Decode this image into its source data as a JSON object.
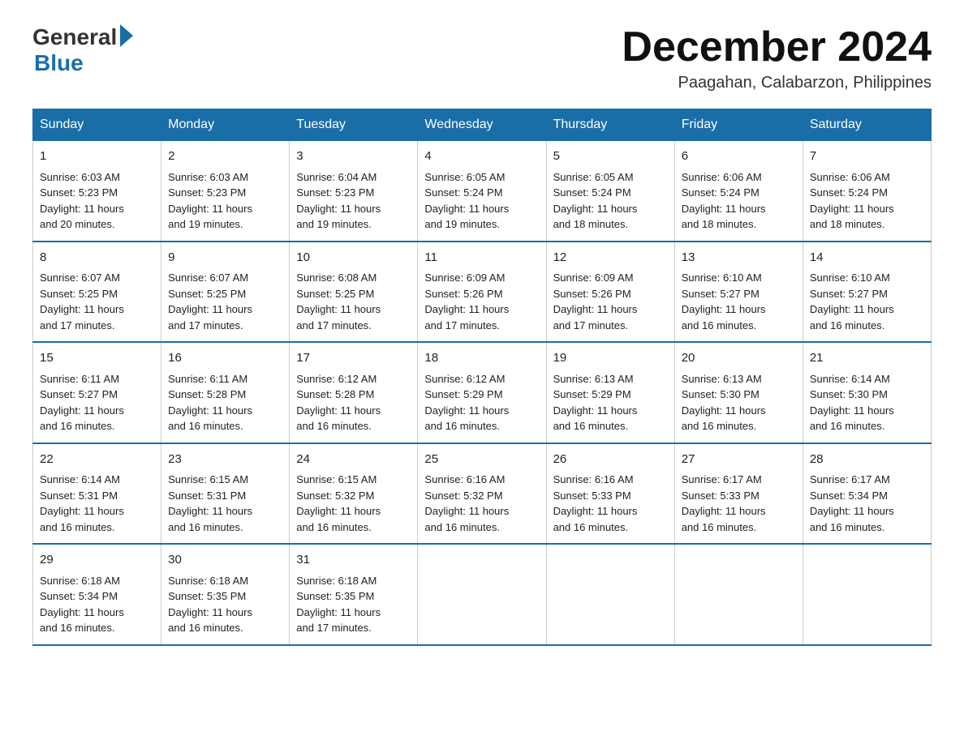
{
  "header": {
    "logo_general": "General",
    "logo_blue": "Blue",
    "month_title": "December 2024",
    "location": "Paagahan, Calabarzon, Philippines"
  },
  "days_of_week": [
    "Sunday",
    "Monday",
    "Tuesday",
    "Wednesday",
    "Thursday",
    "Friday",
    "Saturday"
  ],
  "weeks": [
    [
      {
        "day": "1",
        "sunrise": "6:03 AM",
        "sunset": "5:23 PM",
        "daylight": "11 hours and 20 minutes."
      },
      {
        "day": "2",
        "sunrise": "6:03 AM",
        "sunset": "5:23 PM",
        "daylight": "11 hours and 19 minutes."
      },
      {
        "day": "3",
        "sunrise": "6:04 AM",
        "sunset": "5:23 PM",
        "daylight": "11 hours and 19 minutes."
      },
      {
        "day": "4",
        "sunrise": "6:05 AM",
        "sunset": "5:24 PM",
        "daylight": "11 hours and 19 minutes."
      },
      {
        "day": "5",
        "sunrise": "6:05 AM",
        "sunset": "5:24 PM",
        "daylight": "11 hours and 18 minutes."
      },
      {
        "day": "6",
        "sunrise": "6:06 AM",
        "sunset": "5:24 PM",
        "daylight": "11 hours and 18 minutes."
      },
      {
        "day": "7",
        "sunrise": "6:06 AM",
        "sunset": "5:24 PM",
        "daylight": "11 hours and 18 minutes."
      }
    ],
    [
      {
        "day": "8",
        "sunrise": "6:07 AM",
        "sunset": "5:25 PM",
        "daylight": "11 hours and 17 minutes."
      },
      {
        "day": "9",
        "sunrise": "6:07 AM",
        "sunset": "5:25 PM",
        "daylight": "11 hours and 17 minutes."
      },
      {
        "day": "10",
        "sunrise": "6:08 AM",
        "sunset": "5:25 PM",
        "daylight": "11 hours and 17 minutes."
      },
      {
        "day": "11",
        "sunrise": "6:09 AM",
        "sunset": "5:26 PM",
        "daylight": "11 hours and 17 minutes."
      },
      {
        "day": "12",
        "sunrise": "6:09 AM",
        "sunset": "5:26 PM",
        "daylight": "11 hours and 17 minutes."
      },
      {
        "day": "13",
        "sunrise": "6:10 AM",
        "sunset": "5:27 PM",
        "daylight": "11 hours and 16 minutes."
      },
      {
        "day": "14",
        "sunrise": "6:10 AM",
        "sunset": "5:27 PM",
        "daylight": "11 hours and 16 minutes."
      }
    ],
    [
      {
        "day": "15",
        "sunrise": "6:11 AM",
        "sunset": "5:27 PM",
        "daylight": "11 hours and 16 minutes."
      },
      {
        "day": "16",
        "sunrise": "6:11 AM",
        "sunset": "5:28 PM",
        "daylight": "11 hours and 16 minutes."
      },
      {
        "day": "17",
        "sunrise": "6:12 AM",
        "sunset": "5:28 PM",
        "daylight": "11 hours and 16 minutes."
      },
      {
        "day": "18",
        "sunrise": "6:12 AM",
        "sunset": "5:29 PM",
        "daylight": "11 hours and 16 minutes."
      },
      {
        "day": "19",
        "sunrise": "6:13 AM",
        "sunset": "5:29 PM",
        "daylight": "11 hours and 16 minutes."
      },
      {
        "day": "20",
        "sunrise": "6:13 AM",
        "sunset": "5:30 PM",
        "daylight": "11 hours and 16 minutes."
      },
      {
        "day": "21",
        "sunrise": "6:14 AM",
        "sunset": "5:30 PM",
        "daylight": "11 hours and 16 minutes."
      }
    ],
    [
      {
        "day": "22",
        "sunrise": "6:14 AM",
        "sunset": "5:31 PM",
        "daylight": "11 hours and 16 minutes."
      },
      {
        "day": "23",
        "sunrise": "6:15 AM",
        "sunset": "5:31 PM",
        "daylight": "11 hours and 16 minutes."
      },
      {
        "day": "24",
        "sunrise": "6:15 AM",
        "sunset": "5:32 PM",
        "daylight": "11 hours and 16 minutes."
      },
      {
        "day": "25",
        "sunrise": "6:16 AM",
        "sunset": "5:32 PM",
        "daylight": "11 hours and 16 minutes."
      },
      {
        "day": "26",
        "sunrise": "6:16 AM",
        "sunset": "5:33 PM",
        "daylight": "11 hours and 16 minutes."
      },
      {
        "day": "27",
        "sunrise": "6:17 AM",
        "sunset": "5:33 PM",
        "daylight": "11 hours and 16 minutes."
      },
      {
        "day": "28",
        "sunrise": "6:17 AM",
        "sunset": "5:34 PM",
        "daylight": "11 hours and 16 minutes."
      }
    ],
    [
      {
        "day": "29",
        "sunrise": "6:18 AM",
        "sunset": "5:34 PM",
        "daylight": "11 hours and 16 minutes."
      },
      {
        "day": "30",
        "sunrise": "6:18 AM",
        "sunset": "5:35 PM",
        "daylight": "11 hours and 16 minutes."
      },
      {
        "day": "31",
        "sunrise": "6:18 AM",
        "sunset": "5:35 PM",
        "daylight": "11 hours and 17 minutes."
      },
      null,
      null,
      null,
      null
    ]
  ],
  "labels": {
    "sunrise": "Sunrise:",
    "sunset": "Sunset:",
    "daylight": "Daylight:"
  }
}
